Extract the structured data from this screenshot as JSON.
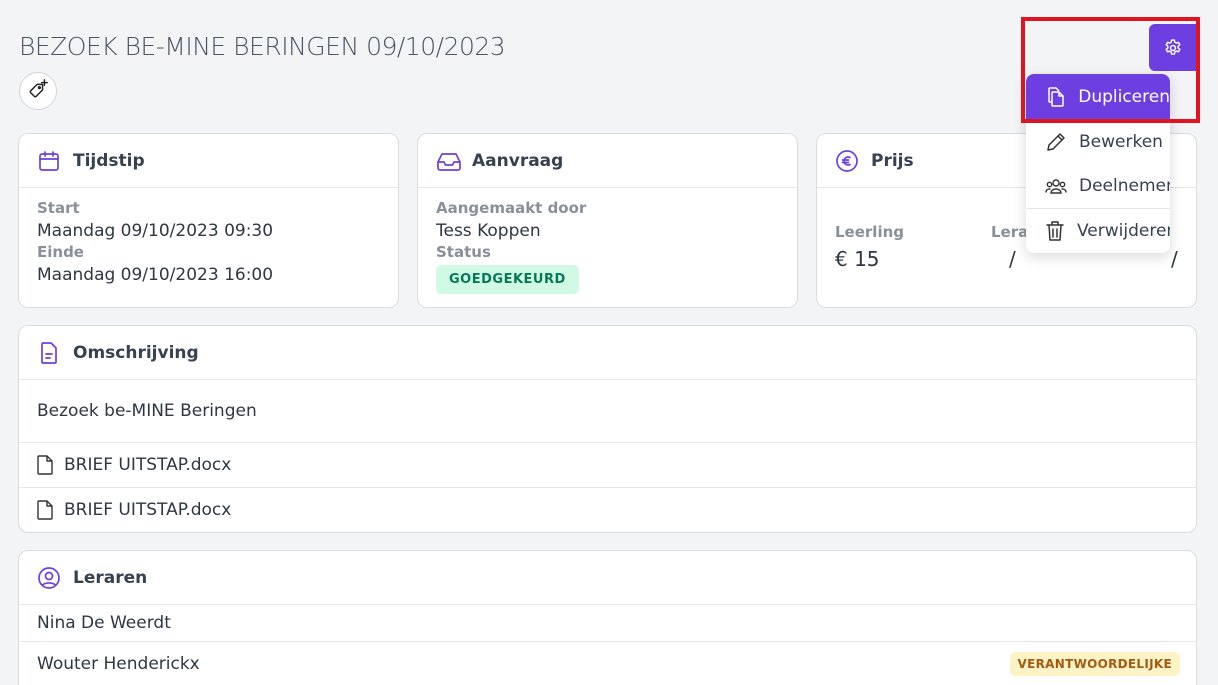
{
  "page": {
    "title": "BEZOEK BE-MINE BERINGEN 09/10/2023"
  },
  "cards": {
    "tijdstip": {
      "title": "Tijdstip",
      "start_label": "Start",
      "start_value": "Maandag 09/10/2023 09:30",
      "end_label": "Einde",
      "end_value": "Maandag 09/10/2023 16:00"
    },
    "aanvraag": {
      "title": "Aanvraag",
      "created_label": "Aangemaakt door",
      "created_value": "Tess Koppen",
      "status_label": "Status",
      "status_value": "GOEDGEKEURD"
    },
    "prijs": {
      "title": "Prijs",
      "student_label": "Leerling",
      "student_value": "€ 15",
      "teacher_label": "Leraa",
      "teacher_value": "/",
      "other_value": "/"
    }
  },
  "omschrijving": {
    "title": "Omschrijving",
    "text": "Bezoek be-MINE Beringen",
    "files": [
      "BRIEF UITSTAP.docx",
      "BRIEF UITSTAP.docx"
    ]
  },
  "leraren": {
    "title": "Leraren",
    "rows": [
      {
        "name": "Nina De Weerdt",
        "badge": ""
      },
      {
        "name": "Wouter Henderickx",
        "badge": "VERANTWOORDELIJKE"
      }
    ]
  },
  "menu": {
    "items": [
      {
        "label": "Dupliceren",
        "icon": "copy-icon",
        "active": true
      },
      {
        "label": "Bewerken",
        "icon": "pencil-icon"
      },
      {
        "label": "Deelnemers",
        "icon": "users-icon"
      },
      {
        "label": "Verwijderen",
        "icon": "trash-icon"
      }
    ]
  },
  "colors": {
    "accent": "#6d3fe0",
    "highlight": "#e0141e",
    "success_bg": "#d1fae5",
    "success_text": "#047857",
    "warning_bg": "#fef3c7",
    "warning_text": "#a35b12"
  }
}
